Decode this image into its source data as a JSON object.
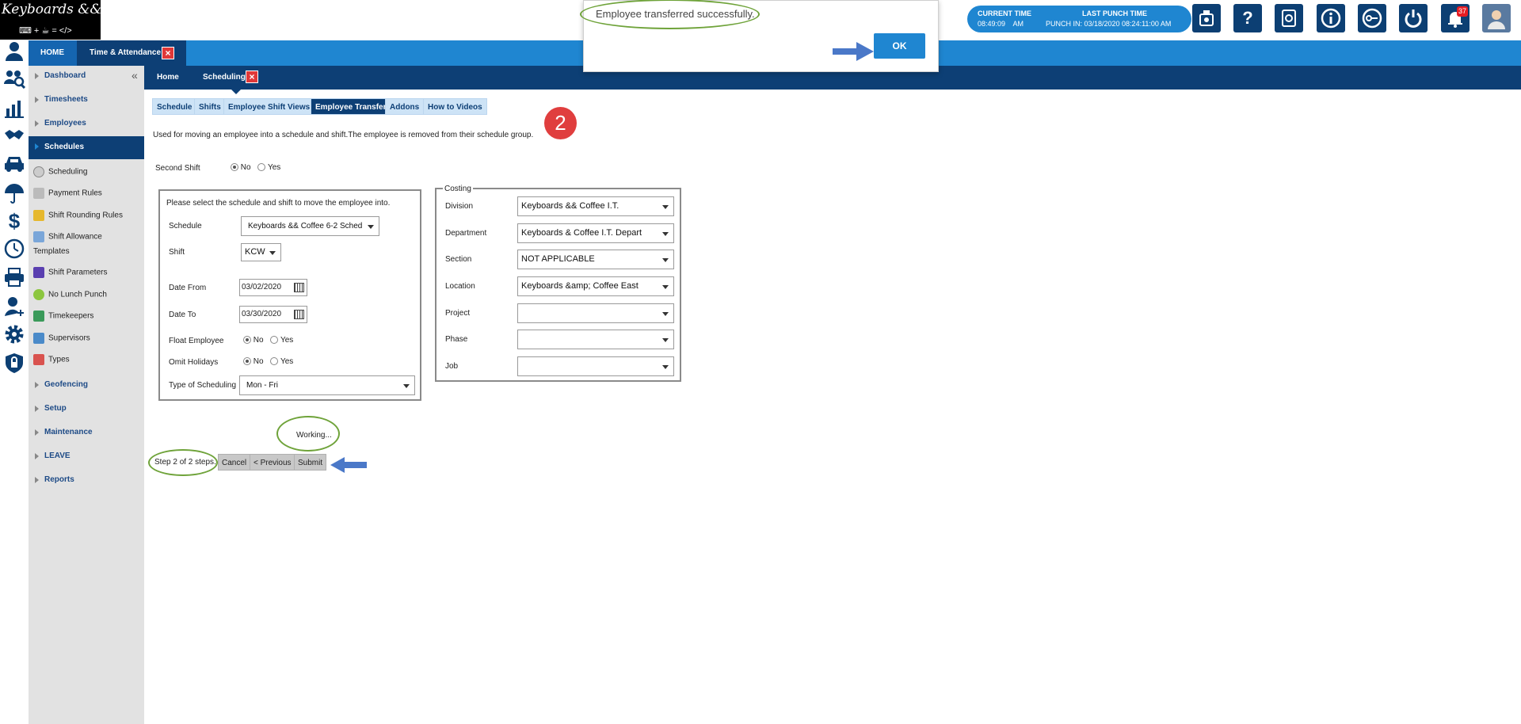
{
  "logo": {
    "title": "Keyboards && Coffee",
    "formula": "⌨ + ☕ = </>"
  },
  "header": {
    "current_time_label": "CURRENT TIME",
    "current_time_value": "08:49:09    AM",
    "last_punch_label": "LAST PUNCH TIME",
    "last_punch_value": "PUNCH IN: 03/18/2020 08:24:11:00 AM",
    "notification_count": "37",
    "icons": [
      "badge-icon",
      "help-icon",
      "document-icon",
      "info-icon",
      "key-icon",
      "power-icon",
      "bell-icon",
      "avatar-icon"
    ]
  },
  "top_tabs": {
    "home": "HOME",
    "time_attendance": "Time & Attendance"
  },
  "sub_tabs": {
    "home": "Home",
    "scheduling": "Scheduling"
  },
  "sidebar": {
    "items": [
      {
        "label": "Dashboard"
      },
      {
        "label": "Timesheets"
      },
      {
        "label": "Employees"
      },
      {
        "label": "Schedules"
      }
    ],
    "sub_items": [
      {
        "label": "Scheduling"
      },
      {
        "label": "Payment Rules"
      },
      {
        "label": "Shift Rounding Rules"
      },
      {
        "label": "Shift Allowance"
      },
      {
        "label": "Templates"
      },
      {
        "label": "Shift Parameters"
      },
      {
        "label": "No Lunch Punch"
      },
      {
        "label": "Timekeepers"
      },
      {
        "label": "Supervisors"
      },
      {
        "label": "Types"
      }
    ],
    "bottom_items": [
      {
        "label": "Geofencing"
      },
      {
        "label": "Setup"
      },
      {
        "label": "Maintenance"
      },
      {
        "label": "LEAVE"
      },
      {
        "label": "Reports"
      }
    ]
  },
  "page_tabs": [
    "Schedule",
    "Shifts",
    "Employee Shift Views",
    "Employee Transfer",
    "Addons",
    "How to Videos"
  ],
  "step_badge": "2",
  "description": "Used for moving an employee into a schedule and shift.The employee is removed from their schedule group.",
  "second_shift": {
    "label": "Second Shift",
    "no": "No",
    "yes": "Yes"
  },
  "schedule_box": {
    "instruction": "Please select the schedule and shift to move the employee into.",
    "schedule_label": "Schedule",
    "schedule_value": "Keyboards && Coffee 6-2 Sched",
    "shift_label": "Shift",
    "shift_value": "KCW",
    "date_from_label": "Date From",
    "date_from_value": "03/02/2020",
    "date_to_label": "Date To",
    "date_to_value": "03/30/2020",
    "float_label": "Float Employee",
    "omit_label": "Omit Holidays",
    "no": "No",
    "yes": "Yes",
    "type_label": "Type of Scheduling",
    "type_value": "Mon - Fri"
  },
  "costing": {
    "legend": "Costing",
    "division_label": "Division",
    "division_value": "Keyboards && Coffee I.T.",
    "department_label": "Department",
    "department_value": "Keyboards & Coffee I.T. Depart",
    "section_label": "Section",
    "section_value": "NOT APPLICABLE",
    "location_label": "Location",
    "location_value": "Keyboards &amp; Coffee East",
    "project_label": "Project",
    "project_value": "",
    "phase_label": "Phase",
    "phase_value": "",
    "job_label": "Job",
    "job_value": ""
  },
  "working_text": "Working...",
  "footer": {
    "step_text": "Step 2 of 2 steps.",
    "cancel": "Cancel",
    "previous": "< Previous",
    "submit": "Submit"
  },
  "dialog": {
    "message": "Employee transferred successfully.",
    "ok": "OK"
  },
  "colors": {
    "primary": "#1f86d1",
    "navy": "#0d3f75",
    "highlight": "#6fa33a",
    "badge": "#e03e3e"
  }
}
